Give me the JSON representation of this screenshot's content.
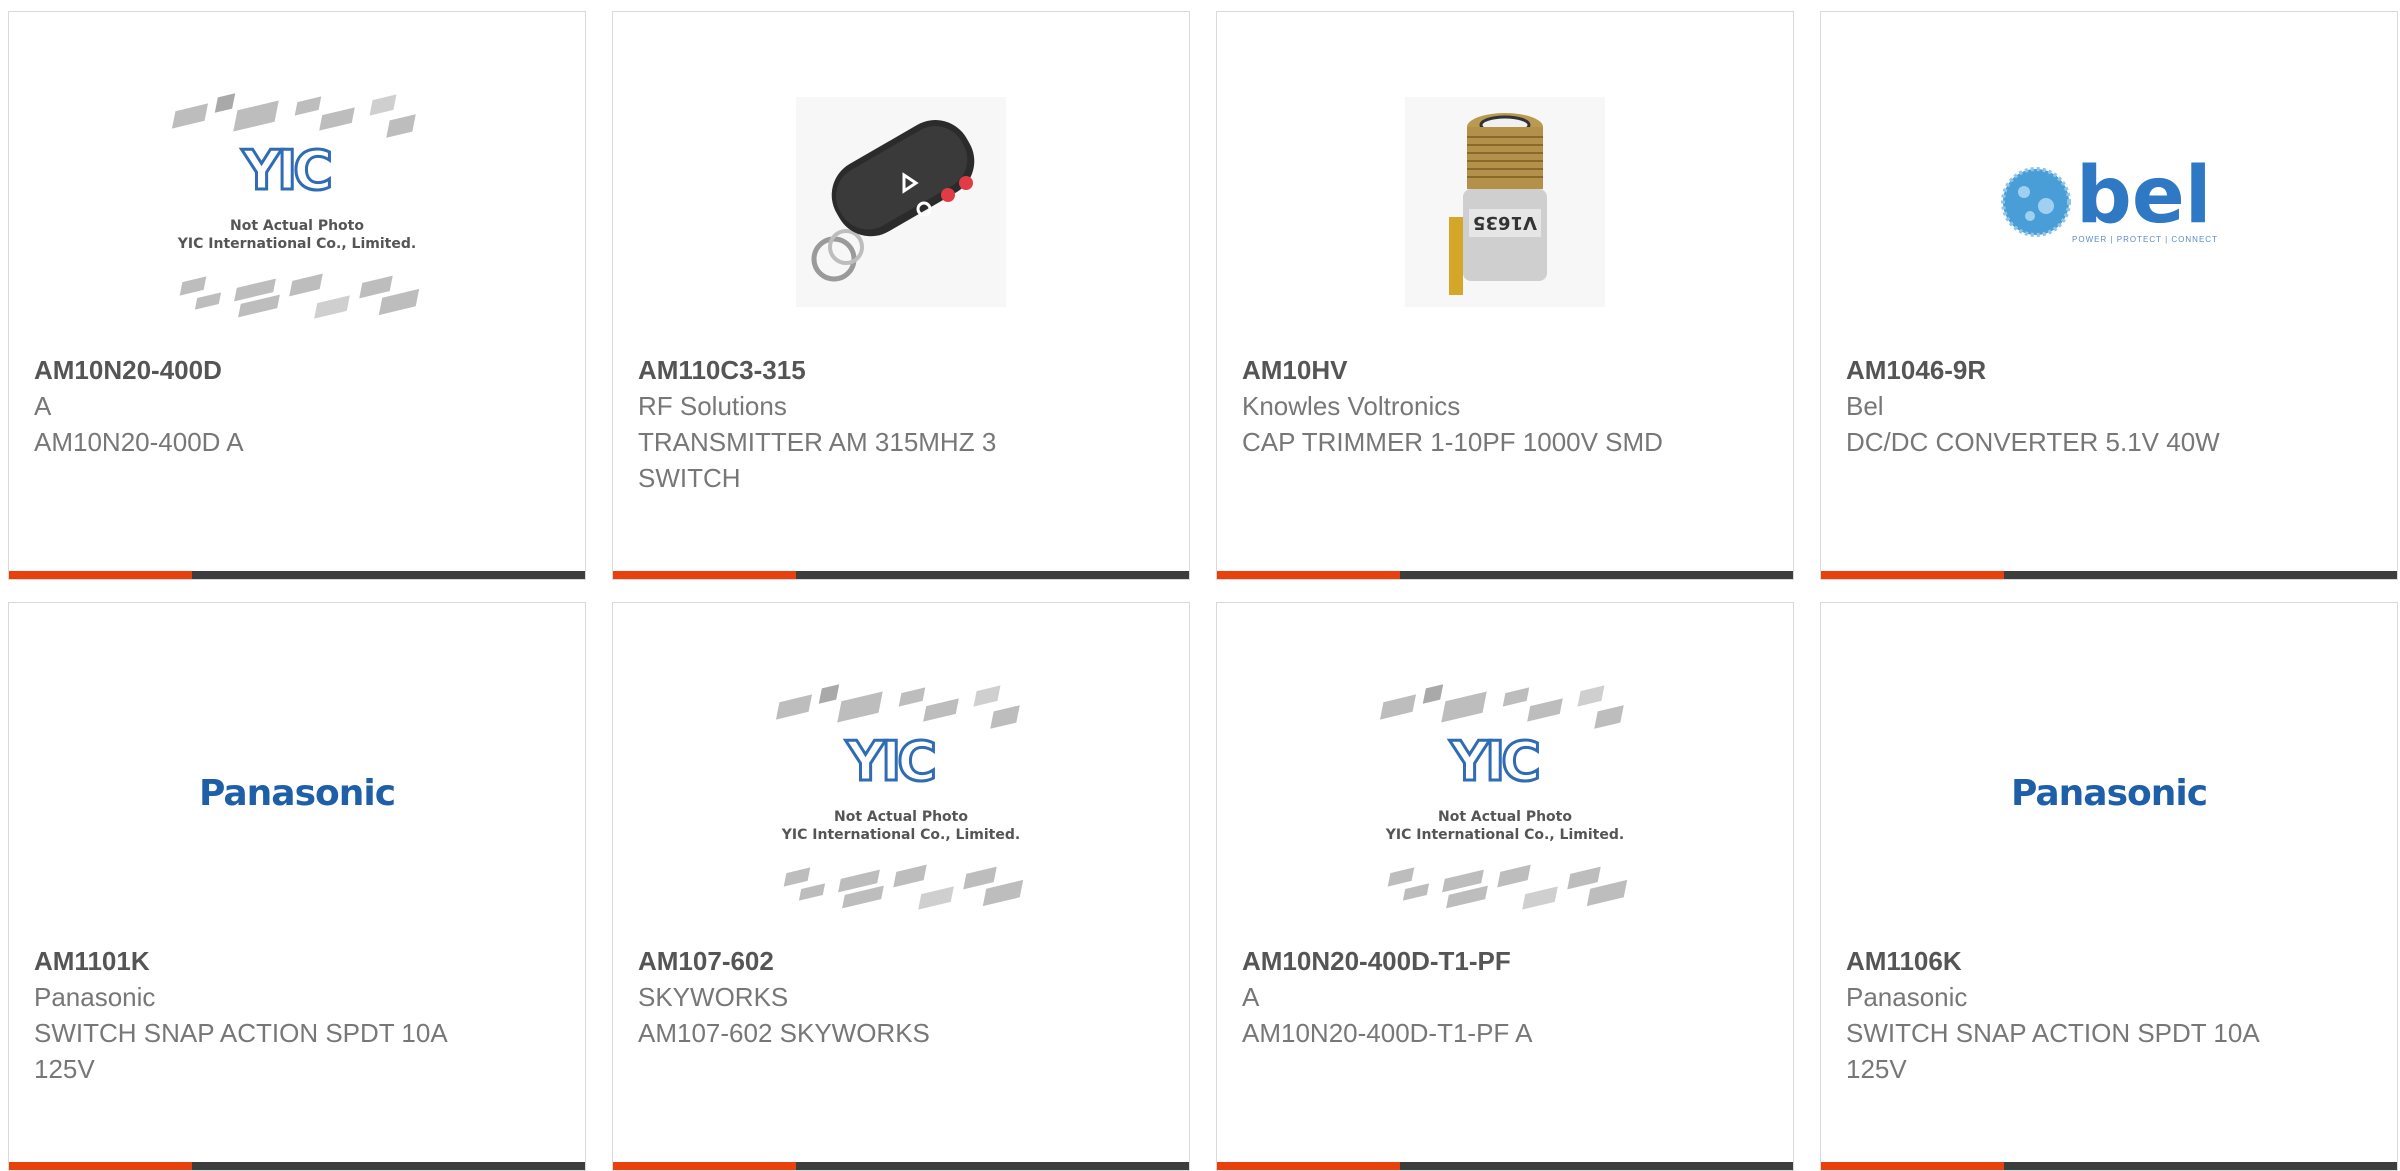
{
  "products": [
    {
      "part": "AM10N20-400D",
      "mfr": "A",
      "desc": "AM10N20-400D A",
      "image": "yic-placeholder"
    },
    {
      "part": "AM110C3-315",
      "mfr": "RF Solutions",
      "desc": "TRANSMITTER AM 315MHZ 3 SWITCH",
      "image": "keyfob"
    },
    {
      "part": "AM10HV",
      "mfr": "Knowles Voltronics",
      "desc": "CAP TRIMMER 1-10PF 1000V SMD",
      "image": "trimmer"
    },
    {
      "part": "AM1046-9R",
      "mfr": "Bel",
      "desc": "DC/DC CONVERTER 5.1V 40W",
      "image": "bel-logo"
    },
    {
      "part": "AM1101K",
      "mfr": "Panasonic",
      "desc": "SWITCH SNAP ACTION SPDT 10A 125V",
      "image": "panasonic-logo"
    },
    {
      "part": "AM107-602",
      "mfr": "SKYWORKS",
      "desc": "AM107-602 SKYWORKS",
      "image": "yic-placeholder"
    },
    {
      "part": "AM10N20-400D-T1-PF",
      "mfr": "A",
      "desc": "AM10N20-400D-T1-PF A",
      "image": "yic-placeholder"
    },
    {
      "part": "AM1106K",
      "mfr": "Panasonic",
      "desc": "SWITCH SNAP ACTION SPDT 10A 125V",
      "image": "panasonic-logo"
    }
  ],
  "placeholder": {
    "logo": "YIC",
    "line1": "Not Actual Photo",
    "line2": "YIC International Co., Limited."
  },
  "logos": {
    "panasonic": "Panasonic",
    "bel": "bel",
    "bel_tagline": "POWER | PROTECT | CONNECT"
  },
  "colors": {
    "accent": "#e8410e",
    "bar": "#3d3d3d",
    "border": "#d9d9d9",
    "part_text": "#555555",
    "body_text": "#777777"
  }
}
